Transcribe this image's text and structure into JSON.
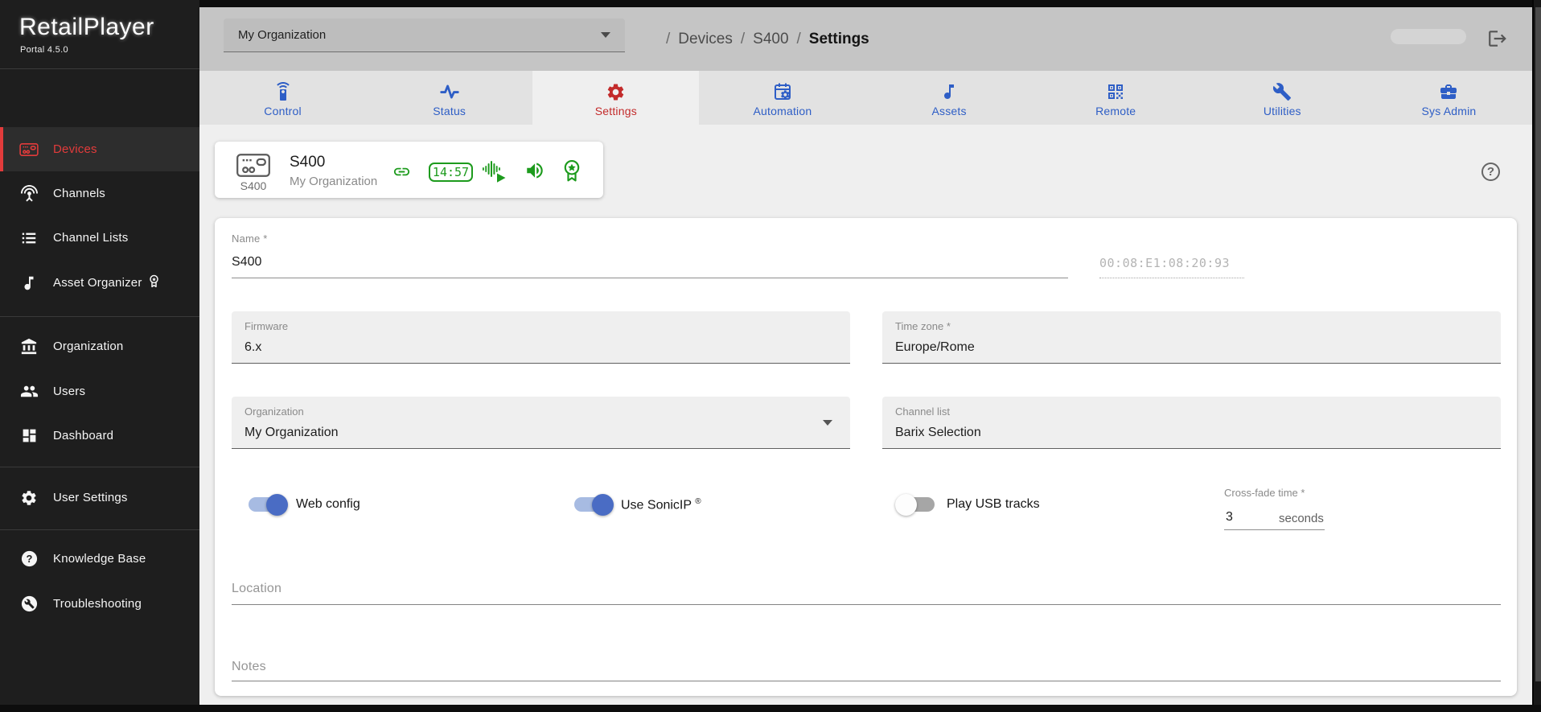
{
  "brand": {
    "name": "RetailPlayer",
    "version": "Portal 4.5.0"
  },
  "sidebar": {
    "items": [
      {
        "label": "Devices",
        "icon": "device-icon",
        "active": true
      },
      {
        "label": "Channels",
        "icon": "antenna-icon",
        "active": false
      },
      {
        "label": "Channel Lists",
        "icon": "list-icon",
        "active": false
      },
      {
        "label": "Asset Organizer",
        "icon": "music-note-icon",
        "active": false,
        "badge": "award-badge-icon"
      },
      {
        "label": "Organization",
        "icon": "bank-icon",
        "active": false
      },
      {
        "label": "Users",
        "icon": "people-icon",
        "active": false
      },
      {
        "label": "Dashboard",
        "icon": "dashboard-icon",
        "active": false
      },
      {
        "label": "User Settings",
        "icon": "gear-icon",
        "active": false
      },
      {
        "label": "Knowledge Base",
        "icon": "help-circle-icon",
        "active": false
      },
      {
        "label": "Troubleshooting",
        "icon": "wrench-circle-icon",
        "active": false
      }
    ]
  },
  "topbar": {
    "org_select": "My Organization",
    "breadcrumb": {
      "sep": "/",
      "item1": "Devices",
      "item2": "S400",
      "item3": "Settings"
    }
  },
  "tabs": {
    "active": "Settings",
    "items": [
      {
        "label": "Control",
        "icon": "remote-control-icon"
      },
      {
        "label": "Status",
        "icon": "pulse-icon"
      },
      {
        "label": "Settings",
        "icon": "gear-icon"
      },
      {
        "label": "Automation",
        "icon": "calendar-gear-icon"
      },
      {
        "label": "Assets",
        "icon": "music-note-icon"
      },
      {
        "label": "Remote",
        "icon": "qr-code-icon"
      },
      {
        "label": "Utilities",
        "icon": "wrench-icon"
      },
      {
        "label": "Sys Admin",
        "icon": "toolbox-icon"
      }
    ]
  },
  "device_card": {
    "icon_caption": "S400",
    "title": "S400",
    "subtitle": "My Organization",
    "time": "14:57",
    "status_icons": [
      "link-icon",
      "clock-badge",
      "audio-wave-play-icon",
      "speaker-icon",
      "award-icon"
    ]
  },
  "form": {
    "name": {
      "label": "Name *",
      "value": "S400"
    },
    "mac": {
      "value": "00:08:E1:08:20:93"
    },
    "firmware": {
      "label": "Firmware",
      "value": "6.x"
    },
    "timezone": {
      "label": "Time zone *",
      "value": "Europe/Rome"
    },
    "organization": {
      "label": "Organization",
      "value": "My Organization"
    },
    "channel_list": {
      "label": "Channel list",
      "value": "Barix Selection"
    },
    "toggles": {
      "web_config": {
        "label": "Web config",
        "on": true
      },
      "sonic_ip": {
        "label": "Use SonicIP",
        "reg_mark": "®",
        "on": true
      },
      "usb_tracks": {
        "label": "Play USB tracks",
        "on": false
      }
    },
    "crossfade": {
      "label": "Cross-fade time *",
      "value": "3",
      "suffix": "seconds"
    },
    "location": {
      "label": "Location",
      "value": ""
    },
    "notes": {
      "label": "Notes",
      "value": ""
    }
  },
  "colors": {
    "accent_red": "#e23b3b",
    "tab_blue": "#2e5ec6",
    "status_green": "#1d9b1d",
    "toggle_on": "#4a6cc4",
    "sidebar_bg": "#1e1e1e",
    "topbar_bg": "#c5c5c5"
  }
}
